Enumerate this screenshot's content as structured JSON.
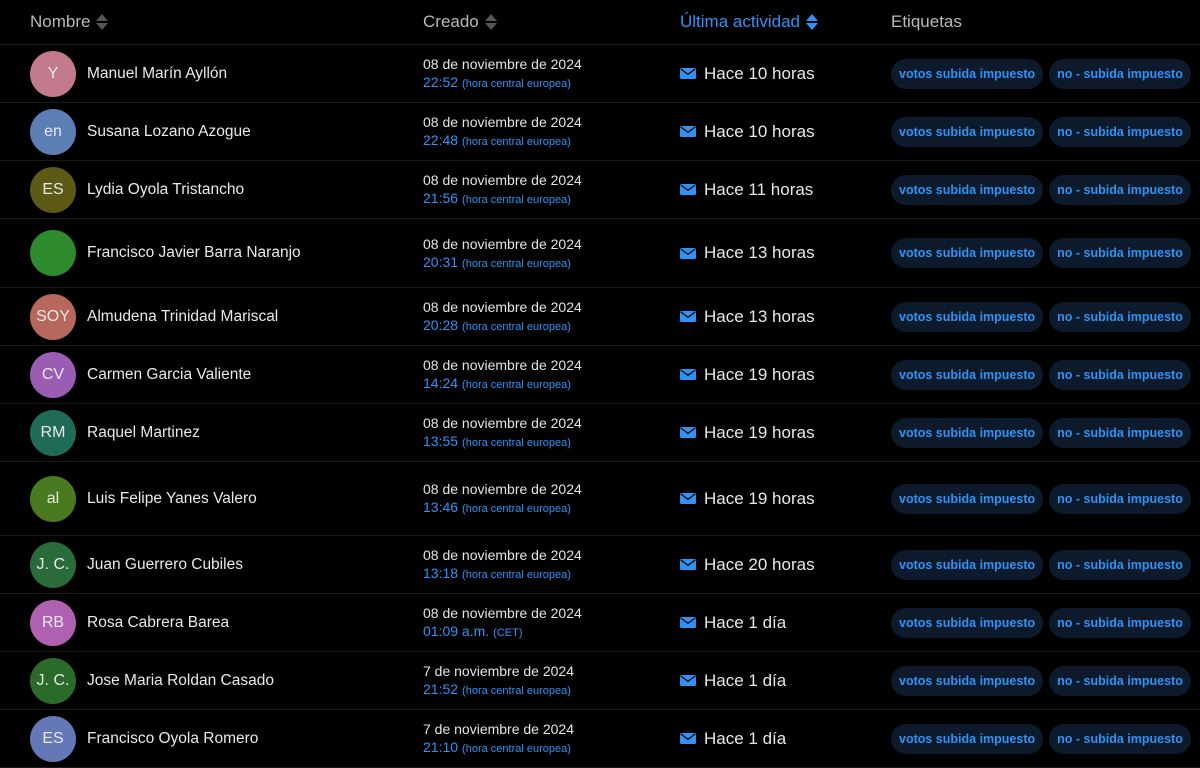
{
  "header": {
    "name": "Nombre",
    "created": "Creado",
    "activity": "Última actividad",
    "tags": "Etiquetas"
  },
  "colors": {
    "accent": "#2f93f5",
    "tag_bg": "#0c1a2c"
  },
  "rows": [
    {
      "initials": "Y",
      "color": "#c27a8c",
      "name": "Manuel Marín Ayllón",
      "date": "08 de noviembre de 2024",
      "time": "22:52",
      "tz": "(hora central europea)",
      "activity": "Hace 10 horas",
      "tags": [
        "votos subida impuesto",
        "no - subida impuesto"
      ]
    },
    {
      "initials": "en",
      "color": "#5b7fb4",
      "name": "Susana Lozano Azogue",
      "date": "08 de noviembre de 2024",
      "time": "22:48",
      "tz": "(hora central europea)",
      "activity": "Hace 10 horas",
      "tags": [
        "votos subida impuesto",
        "no - subida impuesto"
      ]
    },
    {
      "initials": "ES",
      "color": "#5c5a14",
      "name": "Lydia Oyola Tristancho",
      "date": "08 de noviembre de 2024",
      "time": "21:56",
      "tz": "(hora central europea)",
      "activity": "Hace 11 horas",
      "tags": [
        "votos subida impuesto",
        "no - subida impuesto"
      ]
    },
    {
      "initials": "",
      "color": "#2d8a2d",
      "name": "Francisco Javier Barra Naranjo",
      "date": "08 de noviembre de 2024",
      "time": "20:31",
      "tz": "(hora central europea)",
      "activity": "Hace 13 horas",
      "tags": [
        "votos subida impuesto",
        "no - subida impuesto"
      ]
    },
    {
      "initials": "SOY",
      "color": "#b8675c",
      "name": "Almudena Trinidad Mariscal",
      "date": "08 de noviembre de 2024",
      "time": "20:28",
      "tz": "(hora central europea)",
      "activity": "Hace 13 horas",
      "tags": [
        "votos subida impuesto",
        "no - subida impuesto"
      ]
    },
    {
      "initials": "CV",
      "color": "#9b5cb4",
      "name": "Carmen Garcia Valiente",
      "date": "08 de noviembre de 2024",
      "time": "14:24",
      "tz": "(hora central europea)",
      "activity": "Hace 19 horas",
      "tags": [
        "votos subida impuesto",
        "no - subida impuesto"
      ]
    },
    {
      "initials": "RM",
      "color": "#1f6b58",
      "name": "Raquel Martinez",
      "date": "08 de noviembre de 2024",
      "time": "13:55",
      "tz": "(hora central europea)",
      "activity": "Hace 19 horas",
      "tags": [
        "votos subida impuesto",
        "no - subida impuesto"
      ]
    },
    {
      "initials": "al",
      "color": "#4a7a1f",
      "name": "Luis Felipe Yanes Valero",
      "date": "08 de noviembre de 2024",
      "time": "13:46",
      "tz": "(hora central europea)",
      "activity": "Hace 19 horas",
      "tags": [
        "votos subida impuesto",
        "no - subida impuesto"
      ]
    },
    {
      "initials": "J. C.",
      "color": "#2a6b3a",
      "name": "Juan Guerrero Cubiles",
      "date": "08 de noviembre de 2024",
      "time": "13:18",
      "tz": "(hora central europea)",
      "activity": "Hace 20 horas",
      "tags": [
        "votos subida impuesto",
        "no - subida impuesto"
      ]
    },
    {
      "initials": "RB",
      "color": "#b060b0",
      "name": "Rosa Cabrera Barea",
      "date": "08 de noviembre de 2024",
      "time": "01:09 a.m.",
      "tz": "(CET)",
      "activity": "Hace 1 día",
      "tags": [
        "votos subida impuesto",
        "no - subida impuesto"
      ]
    },
    {
      "initials": "J. C.",
      "color": "#2a6b2a",
      "name": "Jose Maria Roldan Casado",
      "date": "7 de noviembre de 2024",
      "time": "21:52",
      "tz": "(hora central europea)",
      "activity": "Hace 1 día",
      "tags": [
        "votos subida impuesto",
        "no - subida impuesto"
      ]
    },
    {
      "initials": "ES",
      "color": "#6478b8",
      "name": "Francisco Oyola Romero",
      "date": "7 de noviembre de 2024",
      "time": "21:10",
      "tz": "(hora central europea)",
      "activity": "Hace 1 día",
      "tags": [
        "votos subida impuesto",
        "no - subida impuesto"
      ]
    }
  ]
}
